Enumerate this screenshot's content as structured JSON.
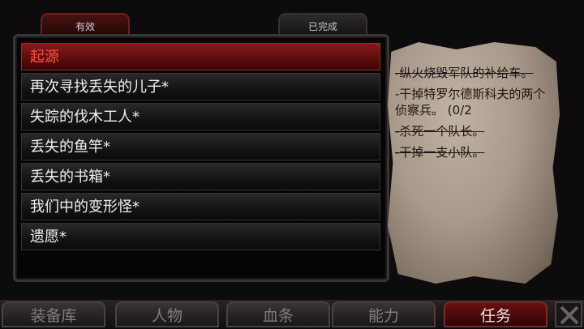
{
  "tabs": {
    "active": "有效",
    "completed": "已完成"
  },
  "quests": [
    {
      "label": "起源",
      "selected": true
    },
    {
      "label": "再次寻找丢失的儿子*"
    },
    {
      "label": "失踪的伐木工人*"
    },
    {
      "label": "丢失的鱼竿*"
    },
    {
      "label": "丢失的书箱*"
    },
    {
      "label": "我们中的变形怪*"
    },
    {
      "label": "遗愿*"
    }
  ],
  "objectives": [
    {
      "text": "-纵火烧毁军队的补给车。",
      "done": true
    },
    {
      "text": "-干掉特罗尔德斯科夫的两个侦察兵。 (0/2",
      "done": false
    },
    {
      "text": "-杀死一个队长。",
      "done": true
    },
    {
      "text": "-干掉一支小队。",
      "done": true
    }
  ],
  "nav": {
    "inventory": "装备库",
    "characters": "人物",
    "bloodline": "血条",
    "abilities": "能力",
    "quests": "任务"
  },
  "close_icon": "close-x-icon"
}
